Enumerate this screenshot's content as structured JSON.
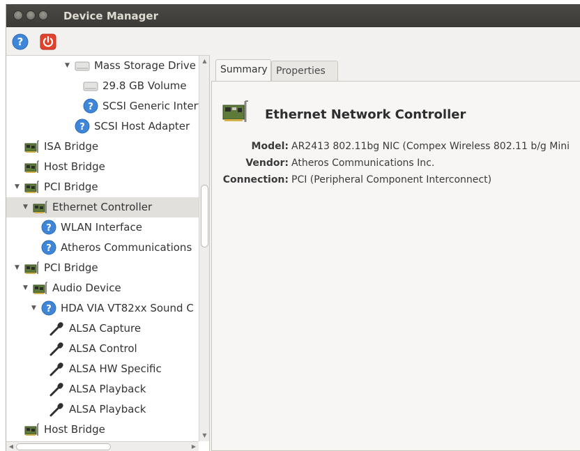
{
  "window": {
    "title": "Device Manager"
  },
  "toolbar": {
    "help_icon": "help-icon",
    "power_icon": "power-icon"
  },
  "tree": [
    {
      "label": "Mass Storage Drive",
      "depth": 7,
      "expanded": true,
      "icon": "drive-icon"
    },
    {
      "label": "29.8 GB Volume",
      "depth": 8,
      "icon": "drive-icon"
    },
    {
      "label": "SCSI Generic Interfa",
      "depth": 8,
      "icon": "help-icon"
    },
    {
      "label": "SCSI Host Adapter",
      "depth": 7,
      "icon": "help-icon"
    },
    {
      "label": "ISA Bridge",
      "depth": 1,
      "icon": "card-icon"
    },
    {
      "label": "Host Bridge",
      "depth": 1,
      "icon": "card-icon"
    },
    {
      "label": "PCI Bridge",
      "depth": 1,
      "expanded": true,
      "icon": "card-icon"
    },
    {
      "label": "Ethernet Controller",
      "depth": 2,
      "expanded": true,
      "icon": "card-icon",
      "selected": true
    },
    {
      "label": "WLAN Interface",
      "depth": 3,
      "icon": "help-icon"
    },
    {
      "label": "Atheros Communications",
      "depth": 3,
      "icon": "help-icon"
    },
    {
      "label": "PCI Bridge",
      "depth": 1,
      "expanded": true,
      "icon": "card-icon"
    },
    {
      "label": "Audio Device",
      "depth": 2,
      "expanded": true,
      "icon": "card-icon"
    },
    {
      "label": "HDA VIA VT82xx Sound C",
      "depth": 3,
      "expanded": true,
      "icon": "help-icon"
    },
    {
      "label": "ALSA Capture",
      "depth": 4,
      "icon": "microphone-icon"
    },
    {
      "label": "ALSA Control",
      "depth": 4,
      "icon": "microphone-icon"
    },
    {
      "label": "ALSA HW Specific",
      "depth": 4,
      "icon": "microphone-icon"
    },
    {
      "label": "ALSA Playback",
      "depth": 4,
      "icon": "microphone-icon"
    },
    {
      "label": "ALSA Playback",
      "depth": 4,
      "icon": "microphone-icon"
    },
    {
      "label": "Host Bridge",
      "depth": 1,
      "icon": "card-icon"
    }
  ],
  "tabs": [
    {
      "label": "Summary",
      "active": true
    },
    {
      "label": "Properties",
      "active": false
    }
  ],
  "summary": {
    "title": "Ethernet Network Controller",
    "icon": "network-card-icon",
    "fields": [
      {
        "key": "Model:",
        "value": "AR2413 802.11bg NIC (Compex Wireless 802.11 b/g Mini"
      },
      {
        "key": "Vendor:",
        "value": "Atheros Communications Inc."
      },
      {
        "key": "Connection:",
        "value": "PCI (Peripheral Component Interconnect)"
      }
    ]
  }
}
